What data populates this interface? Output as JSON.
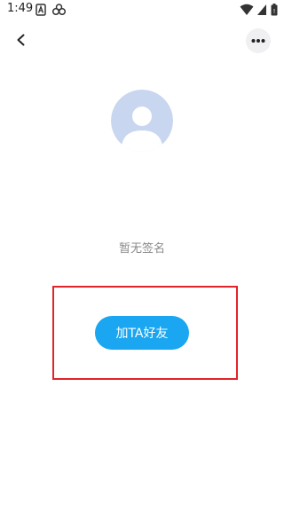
{
  "status_bar": {
    "time": "1:49",
    "icons": [
      "notification-a-icon",
      "infinity-icon",
      "wifi-icon",
      "signal-icon",
      "battery-icon"
    ]
  },
  "nav": {
    "back_icon": "chevron-left-icon",
    "more_icon": "more-horizontal-icon"
  },
  "profile": {
    "avatar_icon": "default-user-avatar-icon",
    "signature": "暂无签名"
  },
  "actions": {
    "add_friend_label": "加TA好友"
  },
  "colors": {
    "accent": "#1aa6f0",
    "highlight": "#e0242a",
    "avatar_bg": "#c8d6ef"
  }
}
